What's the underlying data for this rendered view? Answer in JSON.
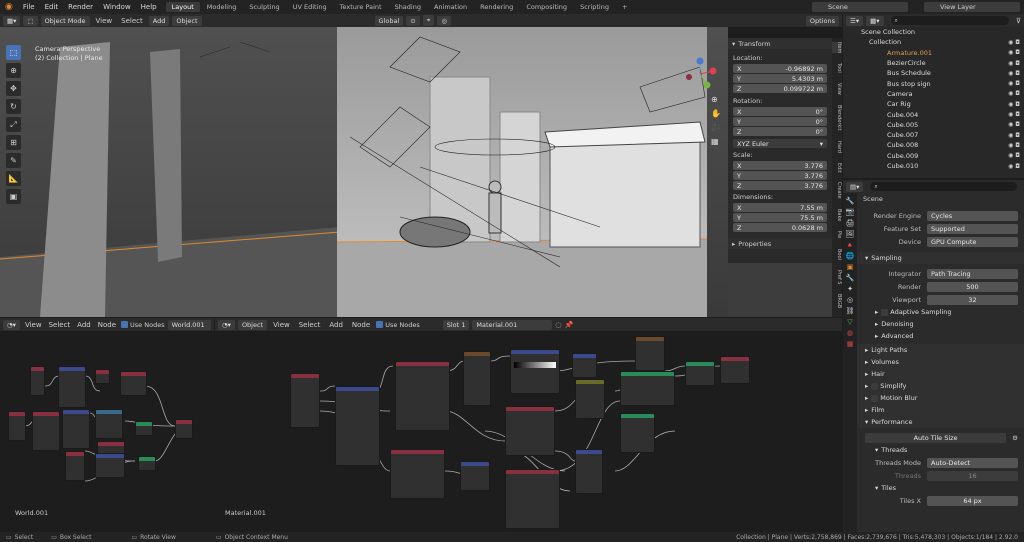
{
  "topbar": {
    "menus": [
      "File",
      "Edit",
      "Render",
      "Window",
      "Help"
    ],
    "workspaces": [
      "Layout",
      "Modeling",
      "Sculpting",
      "UV Editing",
      "Texture Paint",
      "Shading",
      "Animation",
      "Rendering",
      "Compositing",
      "Scripting",
      "+"
    ],
    "active_workspace": "Layout",
    "scene": "Scene",
    "view_layer": "View Layer"
  },
  "viewport": {
    "mode": "Object Mode",
    "menus": [
      "View",
      "Select",
      "Add",
      "Object"
    ],
    "orientation": "Global",
    "options": "Options",
    "camera_label": "Camera Perspective",
    "collection_label": "(2) Collection | Plane"
  },
  "transform_panel": {
    "title": "Transform",
    "location_label": "Location:",
    "location": [
      {
        "axis": "X",
        "value": "-0.96892 m"
      },
      {
        "axis": "Y",
        "value": "5.4303 m"
      },
      {
        "axis": "Z",
        "value": "0.099722 m"
      }
    ],
    "rotation_label": "Rotation:",
    "rotation": [
      {
        "axis": "X",
        "value": "0°"
      },
      {
        "axis": "Y",
        "value": "0°"
      },
      {
        "axis": "Z",
        "value": "0°"
      }
    ],
    "rotation_mode": "XYZ Euler",
    "scale_label": "Scale:",
    "scale": [
      {
        "axis": "X",
        "value": "3.776"
      },
      {
        "axis": "Y",
        "value": "3.776"
      },
      {
        "axis": "Z",
        "value": "3.776"
      }
    ],
    "dimensions_label": "Dimensions:",
    "dimensions": [
      {
        "axis": "X",
        "value": "7.55 m"
      },
      {
        "axis": "Y",
        "value": "75.5 m"
      },
      {
        "axis": "Z",
        "value": "0.0628 m"
      }
    ],
    "properties": "Properties",
    "tabs": [
      "Item",
      "Tool",
      "View",
      "Blenderkit",
      "Hard",
      "Edit",
      "Create",
      "Bake",
      "Pie",
      "Bool",
      "Pref S",
      "BRGB"
    ]
  },
  "outliner": {
    "root": "Scene Collection",
    "collection": "Collection",
    "items": [
      "Armature.001",
      "BezierCircle",
      "Bus Schedule",
      "Bus stop sign",
      "Camera",
      "Car Rig",
      "Cube.004",
      "Cube.005",
      "Cube.007",
      "Cube.008",
      "Cube.009",
      "Cube.010"
    ]
  },
  "properties": {
    "scene": "Scene",
    "render_engine_label": "Render Engine",
    "render_engine": "Cycles",
    "feature_set_label": "Feature Set",
    "feature_set": "Supported",
    "device_label": "Device",
    "device": "GPU Compute",
    "sampling": "Sampling",
    "integrator_label": "Integrator",
    "integrator": "Path Tracing",
    "render_label": "Render",
    "render_samples": "500",
    "viewport_label": "Viewport",
    "viewport_samples": "32",
    "sub_sections": [
      "Adaptive Sampling",
      "Denoising",
      "Advanced"
    ],
    "sections": [
      "Light Paths",
      "Volumes",
      "Hair",
      "Simplify",
      "Motion Blur",
      "Film",
      "Performance"
    ],
    "auto_tile": "Auto Tile Size",
    "threads": "Threads",
    "threads_mode_label": "Threads Mode",
    "threads_mode": "Auto-Detect",
    "threads_count_label": "Threads",
    "threads_count": "16",
    "tiles": "Tiles",
    "tiles_x_label": "Tiles X",
    "tiles_x": "64 px"
  },
  "node_editor_left": {
    "menus": [
      "View",
      "Select",
      "Add",
      "Node"
    ],
    "use_nodes": "Use Nodes",
    "world": "World.001",
    "footer": "World.001"
  },
  "node_editor_right": {
    "type": "Object",
    "menus": [
      "View",
      "Select",
      "Add",
      "Node"
    ],
    "use_nodes": "Use Nodes",
    "slot": "Slot 1",
    "material": "Material.001",
    "footer": "Material.001"
  },
  "statusbar": {
    "items": [
      "Select",
      "Box Select",
      "Rotate View",
      "Object Context Menu"
    ],
    "stats": "Collection | Plane | Verts:2,758,869 | Faces:2,739,676 | Tris:5,478,303 | Objects:1/184 | 2.92.0"
  },
  "colors": {
    "accent": "#4772b3",
    "orange": "#e08a2e",
    "header": "#2b2b2b",
    "bg": "#1d1d1d"
  }
}
